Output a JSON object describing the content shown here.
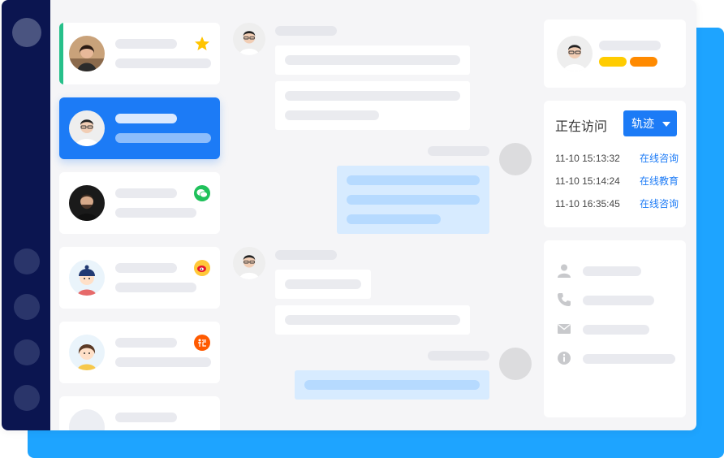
{
  "visit_panel": {
    "title": "正在访问",
    "track_button": "轨迹",
    "entries": [
      {
        "time": "11-10 15:13:32",
        "link": "在线咨询"
      },
      {
        "time": "11-10 15:14:24",
        "link": "在线教育"
      },
      {
        "time": "11-10 16:35:45",
        "link": "在线咨询"
      }
    ]
  },
  "conversations": [
    {
      "channel_icon": "star-icon",
      "active": false
    },
    {
      "channel_icon": "",
      "active": true
    },
    {
      "channel_icon": "wechat-icon",
      "active": false
    },
    {
      "channel_icon": "weibo-icon",
      "active": false
    },
    {
      "channel_icon": "taobao-icon",
      "active": false
    },
    {
      "channel_icon": "",
      "active": false
    }
  ],
  "profile_tags": {
    "colors": [
      "#ffcc00",
      "#ff8a00"
    ]
  },
  "info_icons": [
    "user-icon",
    "phone-icon",
    "mail-icon",
    "info-icon"
  ],
  "colors": {
    "accent": "#1c7bf6",
    "rail": "#0b1550",
    "backplate": "#1ea4ff",
    "active_marker": "#27c08a"
  }
}
